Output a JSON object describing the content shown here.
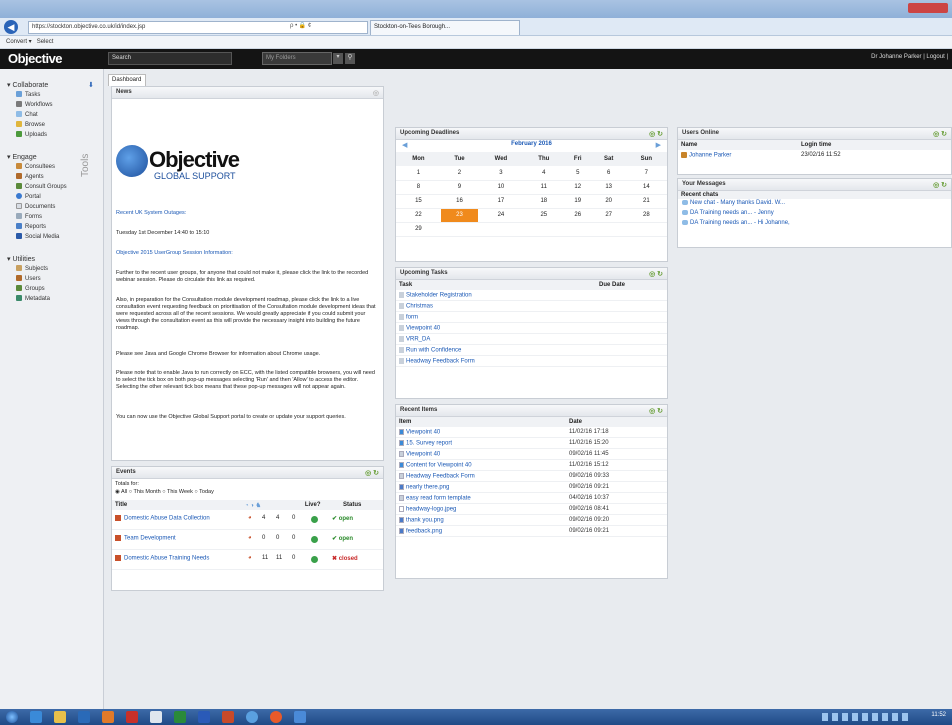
{
  "browser": {
    "url": "https://stockton.objective.co.uk/id/index.jsp",
    "tab_title": "Stockton-on-Tees Borough...",
    "search_glyph": "ρ • 🔒 ¢",
    "convert_label": "Convert",
    "select_label": "Select"
  },
  "app": {
    "logo": "Objective",
    "search_placeholder": "Search",
    "folder_select": "My Folders",
    "user_links": "Dr Johanne Parker  |  Logout  |",
    "tab": "Dashboard"
  },
  "sidebar": {
    "tools_label": "Tools",
    "collaborate": {
      "label": "Collaborate",
      "items": [
        "Tasks",
        "Workflows",
        "Chat",
        "Browse",
        "Uploads"
      ]
    },
    "engage": {
      "label": "Engage",
      "items": [
        "Consultees",
        "Agents",
        "Consult Groups",
        "Portal",
        "Documents",
        "Forms",
        "Reports",
        "Social Media"
      ]
    },
    "utilities": {
      "label": "Utilities",
      "items": [
        "Subjects",
        "Users",
        "Groups",
        "Metadata"
      ]
    }
  },
  "news": {
    "title": "News",
    "logo_main": "Objective",
    "logo_sub": "GLOBAL SUPPORT",
    "outage_heading": "Recent UK System Outages:",
    "outage_text": "Tuesday 1st December 14:40 to 15:10",
    "usergroup_heading": "Objective 2015 UserGroup Session Information:",
    "para1": "Further to the recent user groups, for anyone that could not make it, please click the link to the recorded webinar session. Please do circulate this link as required.",
    "para2": "Also, in preparation for the Consultation module development roadmap, please click the link to a live consultation event requesting feedback on prioritisation of the Consultation module development ideas that were requested across all of the recent sessions. We would greatly appreciate if you could submit your views through the consultation event as this will provide the necessary insight into building the future roadmap.",
    "para3": "Please see Java and Google Chrome Browser for information about Chrome usage.",
    "para4": "Please note that to enable Java to run correctly on ECC, with the listed compatible browsers, you will need to select the tick box on both pop-up messages selecting 'Run' and then 'Allow' to access the editor. Selecting the other relevant tick box means that these pop-up messages will not appear again.",
    "para5": "You can now use the Objective Global Support portal to create or update your support queries."
  },
  "events": {
    "title": "Events",
    "totals_for": "Totals for:",
    "filters": [
      "All",
      "This Month",
      "This Week",
      "Today"
    ],
    "col_title": "Title",
    "col_live": "Live?",
    "col_status": "Status",
    "rows": [
      {
        "title": "Domestic Abuse Data Collection",
        "a": "4",
        "b": "4",
        "c": "0",
        "status": "open"
      },
      {
        "title": "Team Development",
        "a": "0",
        "b": "0",
        "c": "0",
        "status": "open"
      },
      {
        "title": "Domestic Abuse Training Needs",
        "a": "11",
        "b": "11",
        "c": "0",
        "status": "closed"
      }
    ]
  },
  "deadlines": {
    "title": "Upcoming Deadlines",
    "month": "February 2016",
    "days": [
      "Mon",
      "Tue",
      "Wed",
      "Thu",
      "Fri",
      "Sat",
      "Sun"
    ],
    "weeks": [
      [
        "1",
        "2",
        "3",
        "4",
        "5",
        "6",
        "7"
      ],
      [
        "8",
        "9",
        "10",
        "11",
        "12",
        "13",
        "14"
      ],
      [
        "15",
        "16",
        "17",
        "18",
        "19",
        "20",
        "21"
      ],
      [
        "22",
        "23",
        "24",
        "25",
        "26",
        "27",
        "28"
      ],
      [
        "29",
        "",
        "",
        "",
        "",
        "",
        ""
      ]
    ],
    "today": "23"
  },
  "tasks": {
    "title": "Upcoming Tasks",
    "col_task": "Task",
    "col_due": "Due Date",
    "rows": [
      "Stakeholder Registration",
      "Christmas",
      "form",
      "Viewpoint 40",
      "VRR_DA",
      "Run with Confidence",
      "Headway Feedback Form"
    ]
  },
  "recent": {
    "title": "Recent Items",
    "col_item": "Item",
    "col_date": "Date",
    "rows": [
      {
        "item": "Viewpoint 40",
        "date": "11/02/16 17:18"
      },
      {
        "item": "15. Survey report",
        "date": "11/02/16 15:20"
      },
      {
        "item": "Viewpoint 40",
        "date": "09/02/16 11:45"
      },
      {
        "item": "Content for Viewpoint 40",
        "date": "11/02/16 15:12"
      },
      {
        "item": "Headway Feedback Form",
        "date": "09/02/16 09:33"
      },
      {
        "item": "nearly there.png",
        "date": "09/02/16 09:21"
      },
      {
        "item": "easy read form template",
        "date": "04/02/16 10:37"
      },
      {
        "item": "headway-logo.jpeg",
        "date": "09/02/16 08:41"
      },
      {
        "item": "thank you.png",
        "date": "09/02/16 09:20"
      },
      {
        "item": "feedback.png",
        "date": "09/02/16 09:21"
      }
    ]
  },
  "users_online": {
    "title": "Users Online",
    "col_name": "Name",
    "col_login": "Login time",
    "rows": [
      {
        "name": "Johanne Parker",
        "login": "23/02/16 11:52"
      }
    ]
  },
  "messages": {
    "title": "Your Messages",
    "recent_chats": "Recent chats",
    "chats": [
      "New chat - Many thanks David. W...",
      "DA Training needs an... - Jenny",
      "DA Training needs an... - Hi Johanne,"
    ]
  },
  "taskbar": {
    "clock": "11:52"
  }
}
